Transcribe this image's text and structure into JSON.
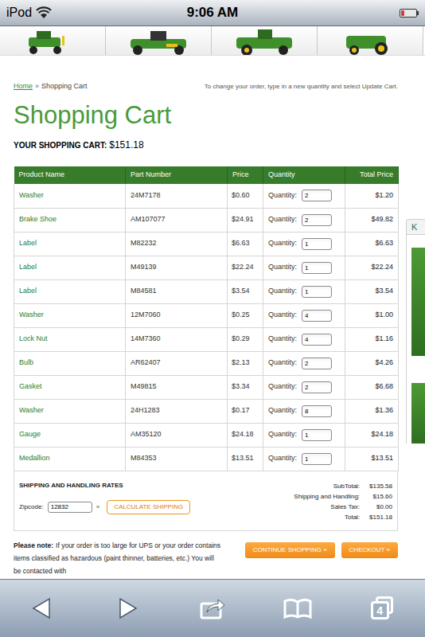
{
  "status_bar": {
    "carrier": "iPod",
    "time": "9:06 AM",
    "battery": {
      "level": 0.2
    }
  },
  "breadcrumb": {
    "home": "Home",
    "separator": "»",
    "current": "Shopping Cart"
  },
  "instructions": "To change your order, type in a new quantity and select Update Cart.",
  "title": "Shopping Cart",
  "cart_summary": {
    "label": "YOUR SHOPPING CART:",
    "total": "$151.18"
  },
  "table": {
    "columns": [
      "Product Name",
      "Part Number",
      "Price",
      "Quantity",
      "Total Price"
    ],
    "rows": [
      {
        "name": "Washer",
        "part": "24M7178",
        "price": "$0.60",
        "quantity_label": "Quantity:",
        "quantity": "2",
        "total": "$1.20"
      },
      {
        "name": "Brake Shoe",
        "part": "AM107077",
        "price": "$24.91",
        "quantity_label": "Quantity:",
        "quantity": "2",
        "total": "$49.82"
      },
      {
        "name": "Label",
        "part": "M82232",
        "price": "$6.63",
        "quantity_label": "Quantity:",
        "quantity": "1",
        "total": "$6.63"
      },
      {
        "name": "Label",
        "part": "M49139",
        "price": "$22.24",
        "quantity_label": "Quantity:",
        "quantity": "1",
        "total": "$22.24"
      },
      {
        "name": "Label",
        "part": "M84581",
        "price": "$3.54",
        "quantity_label": "Quantity:",
        "quantity": "1",
        "total": "$3.54"
      },
      {
        "name": "Washer",
        "part": "12M7060",
        "price": "$0.25",
        "quantity_label": "Quantity:",
        "quantity": "4",
        "total": "$1.00"
      },
      {
        "name": "Lock Nut",
        "part": "14M7360",
        "price": "$0.29",
        "quantity_label": "Quantity:",
        "quantity": "4",
        "total": "$1.16"
      },
      {
        "name": "Bulb",
        "part": "AR62407",
        "price": "$2.13",
        "quantity_label": "Quantity:",
        "quantity": "2",
        "total": "$4.26"
      },
      {
        "name": "Gasket",
        "part": "M49815",
        "price": "$3.34",
        "quantity_label": "Quantity:",
        "quantity": "2",
        "total": "$6.68"
      },
      {
        "name": "Washer",
        "part": "24H1283",
        "price": "$0.17",
        "quantity_label": "Quantity:",
        "quantity": "8",
        "total": "$1.36"
      },
      {
        "name": "Gauge",
        "part": "AM35120",
        "price": "$24.18",
        "quantity_label": "Quantity:",
        "quantity": "1",
        "total": "$24.18"
      },
      {
        "name": "Medallion",
        "part": "M84353",
        "price": "$13.51",
        "quantity_label": "Quantity:",
        "quantity": "1",
        "total": "$13.51"
      }
    ]
  },
  "shipping": {
    "heading": "SHIPPING AND HANDLING RATES",
    "zip_label": "Zipcode:",
    "zip": "12832",
    "arrow": "»",
    "button": "CALCULATE SHIPPING"
  },
  "totals": [
    {
      "label": "SubTotal:",
      "value": "$135.58"
    },
    {
      "label": "Shipping and Handling:",
      "value": "$15.60"
    },
    {
      "label": "Sales Tax:",
      "value": "$0.00"
    },
    {
      "label": "Total:",
      "value": "$151.18"
    }
  ],
  "note": {
    "label": "Please note:",
    "text": "If your order is too large for UPS or your order contains items classified as hazardous (paint thinner, batteries, etc.) You will be contacted with"
  },
  "buttons": [
    "CONTINUE SHOPPING »",
    "CHECKOUT »"
  ],
  "sidebar": {
    "tab": "K"
  },
  "toolbar": {
    "tab_count": "4"
  }
}
